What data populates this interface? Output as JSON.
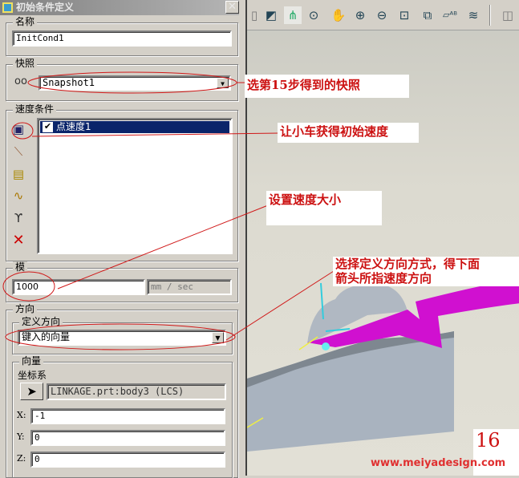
{
  "dialog": {
    "title": "初始条件定义",
    "close_label": "✕",
    "name_group": {
      "label": "名称",
      "value": "InitCond1"
    },
    "snapshot_group": {
      "label": "快照",
      "selected": "Snapshot1"
    },
    "velocity_group": {
      "label": "速度条件",
      "items": [
        {
          "label": "点速度1",
          "checked": true
        }
      ],
      "check_mark": "✔"
    },
    "magnitude_group": {
      "label": "模",
      "value": "1000",
      "units": "mm / sec"
    },
    "direction_group": {
      "label": "方向",
      "define_label": "定义方向",
      "define_selected": "键入的向量",
      "vector_group": {
        "label": "向量",
        "csys_label": "坐标系",
        "csys_value": "LINKAGE.prt:body3 (LCS)",
        "x_label": "X:",
        "x_value": "-1",
        "y_label": "Y:",
        "y_value": "0",
        "z_label": "Z:",
        "z_value": "0"
      }
    }
  },
  "toolbar": {
    "icons": [
      "orient-icon",
      "view-icon",
      "datum-display-icon",
      "spin-center-icon",
      "pan-icon",
      "zoom-in-icon",
      "zoom-out-icon",
      "refit-icon",
      "reorient-icon",
      "named-view-icon",
      "layers-icon",
      "display-style-icon"
    ]
  },
  "annotations": {
    "snapshot_note": "选第15步得到的快照",
    "velocity_note": "让小车获得初始速度",
    "magnitude_note": "设置速度大小",
    "direction_note_line1": "选择定义方向方式，得下面",
    "direction_note_line2": "箭头所指速度方向",
    "step_number": "16",
    "website": "www.meiyadesign.com"
  },
  "colors": {
    "annotation_red": "#cc1111",
    "selection_blue": "#0a246a",
    "arrow_magenta": "#d010d0"
  }
}
